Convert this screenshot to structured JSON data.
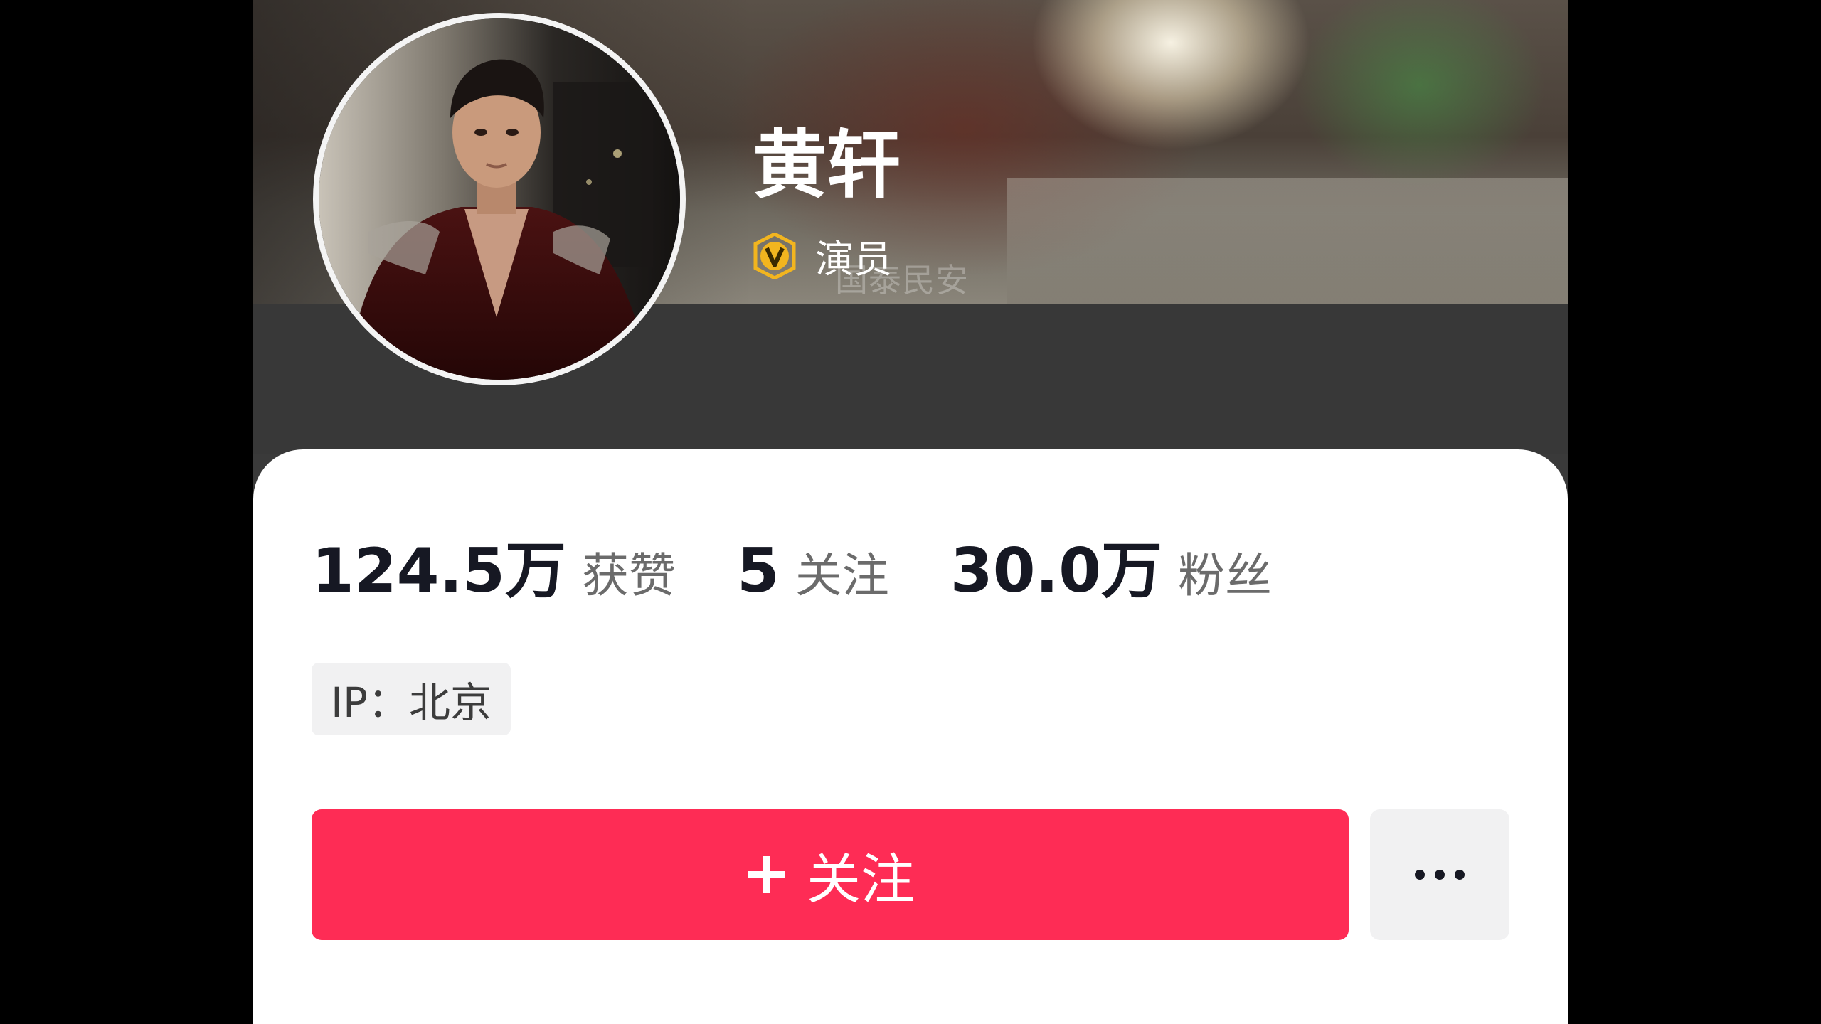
{
  "profile": {
    "username": "黄轩",
    "verification_label": "演员",
    "banner_watermark": "国泰民安",
    "verified_badge_icon": "verified-v-icon",
    "badge_color": "#f2b51f"
  },
  "stats": [
    {
      "value": "124.5万",
      "label": "获赞"
    },
    {
      "value": "5",
      "label": "关注"
    },
    {
      "value": "30.0万",
      "label": "粉丝"
    }
  ],
  "ip_location": "IP：北京",
  "actions": {
    "follow_label": "关注",
    "follow_icon": "plus-icon",
    "more_icon": "ellipsis-icon",
    "accent_color": "#fe2c55"
  }
}
